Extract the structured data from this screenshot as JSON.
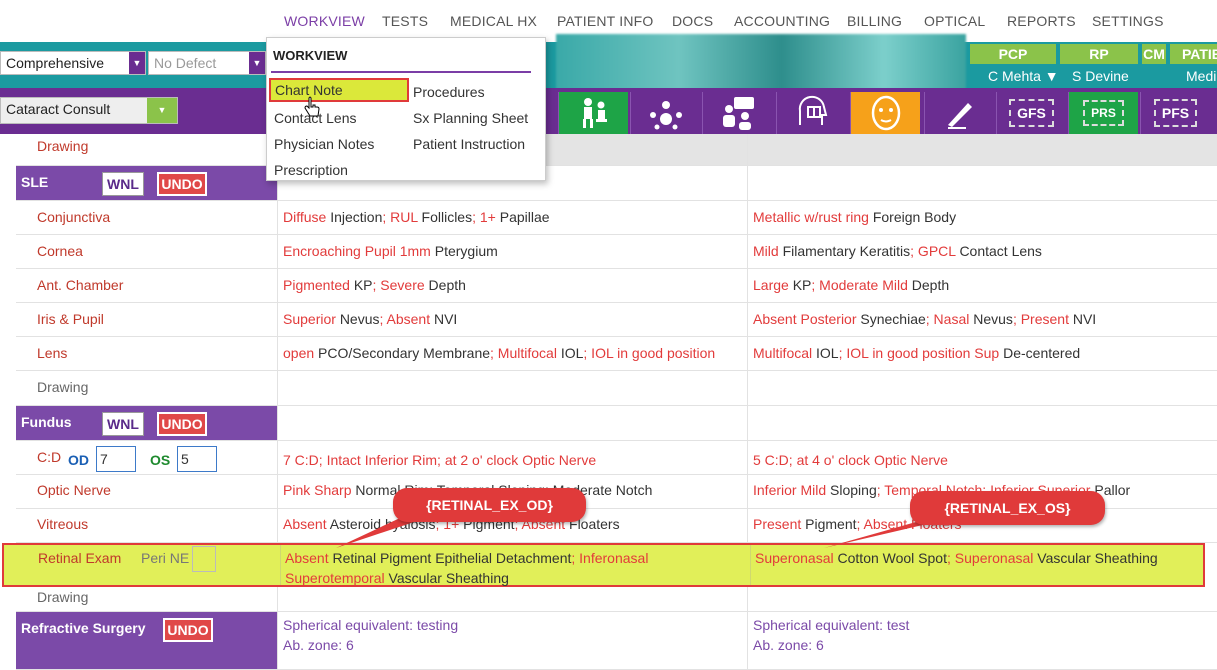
{
  "nav": {
    "items": [
      "WORKVIEW",
      "TESTS",
      "MEDICAL HX",
      "PATIENT INFO",
      "DOCS",
      "ACCOUNTING",
      "BILLING",
      "OPTICAL",
      "REPORTS",
      "SETTINGS"
    ]
  },
  "toolbar": {
    "exam_type": "Comprehensive",
    "defect": "No Defect",
    "visit_type": "Cataract Consult",
    "pcp_label": "PCP",
    "pcp_name": "C Mehta ▼",
    "rp_label": "RP",
    "rp_name": "S Devine",
    "cm_label": "CM",
    "patient_label": "PATIE",
    "patient_value": "Medi",
    "icon_gfs": "GFS",
    "icon_prs": "PRS",
    "icon_pfs": "PFS"
  },
  "menu": {
    "title": "WORKVIEW",
    "left": [
      "Chart Note",
      "Contact Lens",
      "Physician Notes",
      "Prescription"
    ],
    "right": [
      "Procedures",
      "Sx Planning Sheet",
      "Patient Instruction"
    ]
  },
  "grid": {
    "drawing_top": "Drawing",
    "sle": {
      "title": "SLE",
      "wnl": "WNL",
      "undo": "UNDO",
      "rows": [
        {
          "label": "Conjunctiva",
          "od": [
            [
              "r",
              "Diffuse "
            ],
            [
              "d",
              "Injection"
            ],
            [
              "r",
              "; RUL "
            ],
            [
              "d",
              "Follicles"
            ],
            [
              "r",
              "; 1+ "
            ],
            [
              "d",
              "Papillae"
            ]
          ],
          "os": [
            [
              "r",
              "Metallic w/rust ring "
            ],
            [
              "d",
              "Foreign Body"
            ]
          ]
        },
        {
          "label": "Cornea",
          "od": [
            [
              "r",
              "Encroaching Pupil 1mm "
            ],
            [
              "d",
              "Pterygium"
            ]
          ],
          "os": [
            [
              "r",
              "Mild "
            ],
            [
              "d",
              "Filamentary Keratitis"
            ],
            [
              "r",
              "; GPCL "
            ],
            [
              "d",
              "Contact Lens"
            ]
          ]
        },
        {
          "label": "Ant. Chamber",
          "od": [
            [
              "r",
              "Pigmented "
            ],
            [
              "d",
              "KP"
            ],
            [
              "r",
              "; Severe "
            ],
            [
              "d",
              "Depth"
            ]
          ],
          "os": [
            [
              "r",
              "Large "
            ],
            [
              "d",
              "KP"
            ],
            [
              "r",
              "; Moderate Mild "
            ],
            [
              "d",
              "Depth"
            ]
          ]
        },
        {
          "label": "Iris & Pupil",
          "od": [
            [
              "r",
              "Superior "
            ],
            [
              "d",
              "Nevus"
            ],
            [
              "r",
              "; Absent "
            ],
            [
              "d",
              "NVI"
            ]
          ],
          "os": [
            [
              "r",
              "Absent Posterior "
            ],
            [
              "d",
              "Synechiae"
            ],
            [
              "r",
              "; Nasal "
            ],
            [
              "d",
              "Nevus"
            ],
            [
              "r",
              "; Present "
            ],
            [
              "d",
              "NVI"
            ]
          ]
        },
        {
          "label": "Lens",
          "od": [
            [
              "r",
              "open "
            ],
            [
              "d",
              "PCO/Secondary Membrane"
            ],
            [
              "r",
              "; Multifocal "
            ],
            [
              "d",
              "IOL"
            ],
            [
              "r",
              "; IOL in good position"
            ]
          ],
          "os": [
            [
              "r",
              "Multifocal "
            ],
            [
              "d",
              "IOL"
            ],
            [
              "r",
              "; IOL in good position Sup "
            ],
            [
              "d",
              "De-centered"
            ]
          ]
        }
      ],
      "drawing": "Drawing"
    },
    "fundus": {
      "title": "Fundus",
      "wnl": "WNL",
      "undo": "UNDO",
      "cd_label": "C:D",
      "od_label": "OD",
      "od_value": "7",
      "os_label": "OS",
      "os_value": "5",
      "cd_od": [
        [
          "r",
          "7 C:D; Intact Inferior Rim; at 2 o' clock Optic Nerve"
        ]
      ],
      "cd_os": [
        [
          "r",
          "5 C:D; at 4 o' clock Optic Nerve"
        ]
      ],
      "optic_label": "Optic Nerve",
      "optic_od": [
        [
          "r",
          "Pink Sharp "
        ],
        [
          "d",
          "Normal Rim; Temporal Sloping; Moderate Notch"
        ]
      ],
      "optic_os": [
        [
          "r",
          "Inferior Mild "
        ],
        [
          "d",
          "Sloping"
        ],
        [
          "r",
          "; Temporal Notch; Inferior Superior "
        ],
        [
          "d",
          "Pallor"
        ]
      ],
      "vitreous_label": "Vitreous",
      "vitreous_od": [
        [
          "r",
          "Absent "
        ],
        [
          "d",
          "Asteroid hyalosis"
        ],
        [
          "r",
          "; 1+ "
        ],
        [
          "d",
          "Pigment"
        ],
        [
          "r",
          "; Absent "
        ],
        [
          "d",
          "Floaters"
        ]
      ],
      "vitreous_os": [
        [
          "r",
          "Present "
        ],
        [
          "d",
          "Pigment"
        ],
        [
          "r",
          "; Absent Floaters"
        ]
      ],
      "retinal_label": "Retinal Exam",
      "peri_label": "Peri NE",
      "retinal_od": [
        [
          "r",
          "Absent "
        ],
        [
          "d",
          "Retinal Pigment Epithelial Detachment"
        ],
        [
          "r",
          "; Inferonasal"
        ]
      ],
      "retinal_od2": [
        [
          "r",
          "Superotemporal "
        ],
        [
          "d",
          "Vascular Sheathing"
        ]
      ],
      "retinal_os": [
        [
          "r",
          "Superonasal "
        ],
        [
          "d",
          "Cotton Wool Spot"
        ],
        [
          "r",
          "; Superonasal "
        ],
        [
          "d",
          "Vascular Sheathing"
        ]
      ],
      "drawing": "Drawing"
    },
    "refractive": {
      "title": "Refractive Surgery",
      "undo": "UNDO",
      "od1": "Spherical equivalent: testing",
      "od2": "Ab. zone: 6",
      "os1": "Spherical equivalent: test",
      "os2": "Ab. zone: 6"
    }
  },
  "callouts": {
    "od": "{RETINAL_EX_OD}",
    "os": "{RETINAL_EX_OS}"
  },
  "colors": {
    "purple": "#6a2d91",
    "teal": "#1b9aa0",
    "green": "#8bc34a",
    "accent_red": "#e03a3a",
    "highlight": "#dce93c"
  }
}
